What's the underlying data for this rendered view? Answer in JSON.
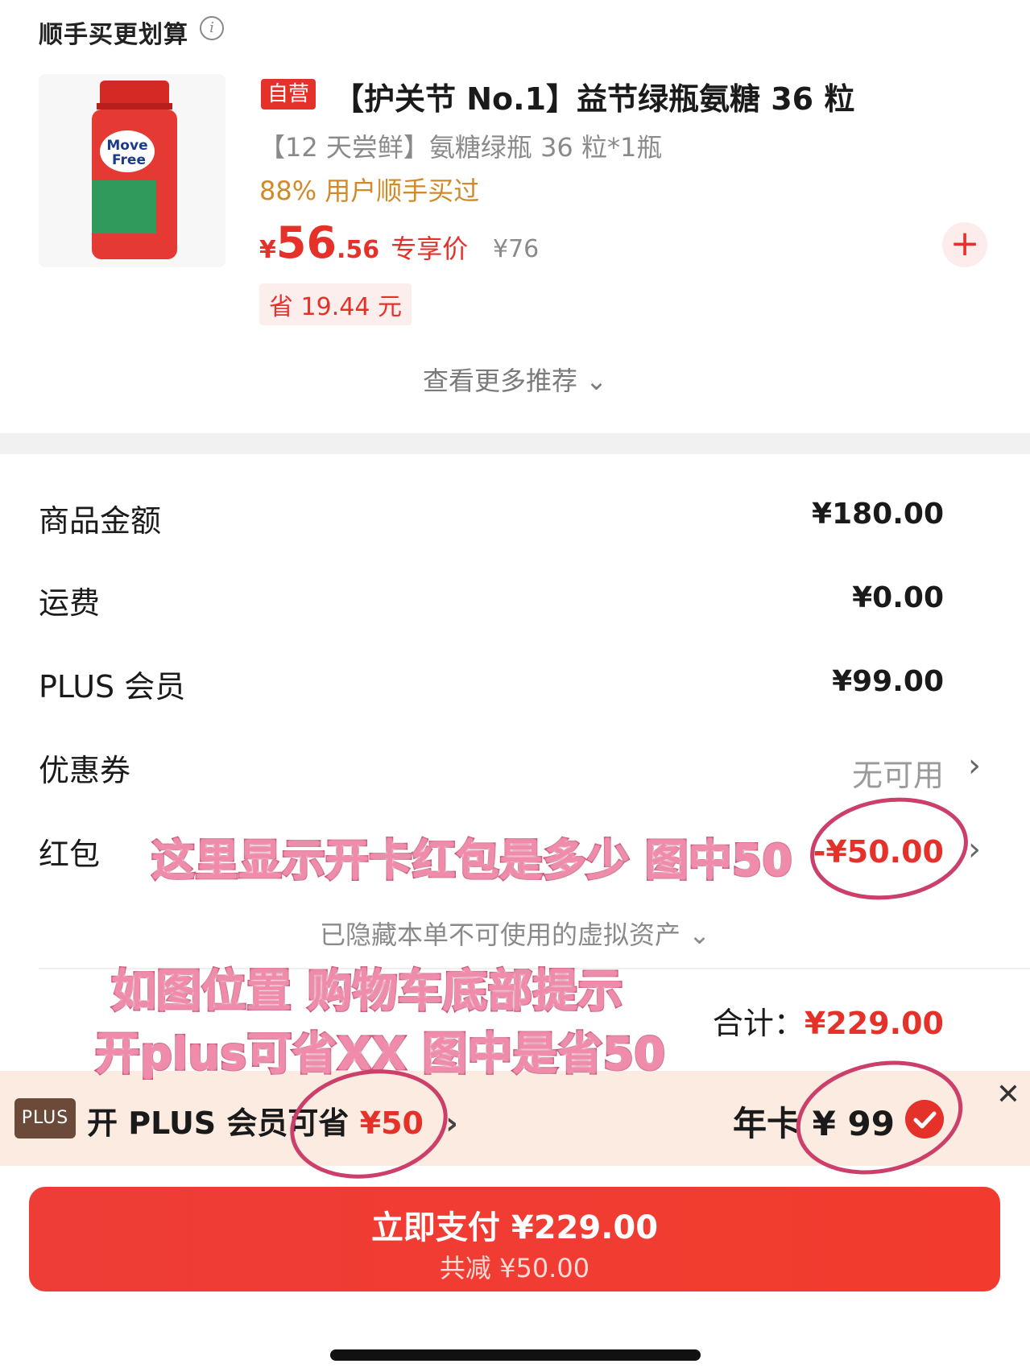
{
  "header": {
    "title": "顺手买更划算"
  },
  "product": {
    "tag": "自营",
    "title": "【护关节 No.1】益节绿瓶氨糖 36 粒",
    "spec": "【12 天尝鲜】氨糖绿瓶 36 粒*1瓶",
    "bought_ratio": "88% 用户顺手买过",
    "price_yen": "¥",
    "price_int": "56",
    "price_dec": ".56",
    "price_label": "专享价",
    "original_price": "¥76",
    "save_text": "省 19.44 元",
    "add_label": "+"
  },
  "more_recommend": "查看更多推荐 ⌄",
  "summary": {
    "goods_label": "商品金额",
    "goods_value": "¥180.00",
    "shipping_label": "运费",
    "shipping_value": "¥0.00",
    "plus_label": "PLUS 会员",
    "plus_value": "¥99.00",
    "coupon_label": "优惠券",
    "coupon_value": "无可用",
    "redpacket_label": "红包",
    "redpacket_value": "-¥50.00",
    "chevron": "›"
  },
  "hidden_assets": "已隐藏本单不可使用的虚拟资产 ⌄",
  "total": {
    "label": "合计：",
    "value": "¥229.00"
  },
  "plus_bar": {
    "badge": "PLUS",
    "text": "开 PLUS 会员可省",
    "save": "¥50",
    "chevron": "›",
    "year_card": "年卡 ¥ 99",
    "close": "✕"
  },
  "pay": {
    "main": "立即支付 ¥229.00",
    "sub": "共减 ¥50.00"
  },
  "annotations": {
    "note1": "这里显示开卡红包是多少 图中50",
    "note2": "如图位置 购物车底部提示",
    "note3": "开plus可省XX 图中是省50"
  },
  "colors": {
    "accent": "#e4322b",
    "banner": "#fbebe1",
    "annotation": "#f08bab"
  }
}
